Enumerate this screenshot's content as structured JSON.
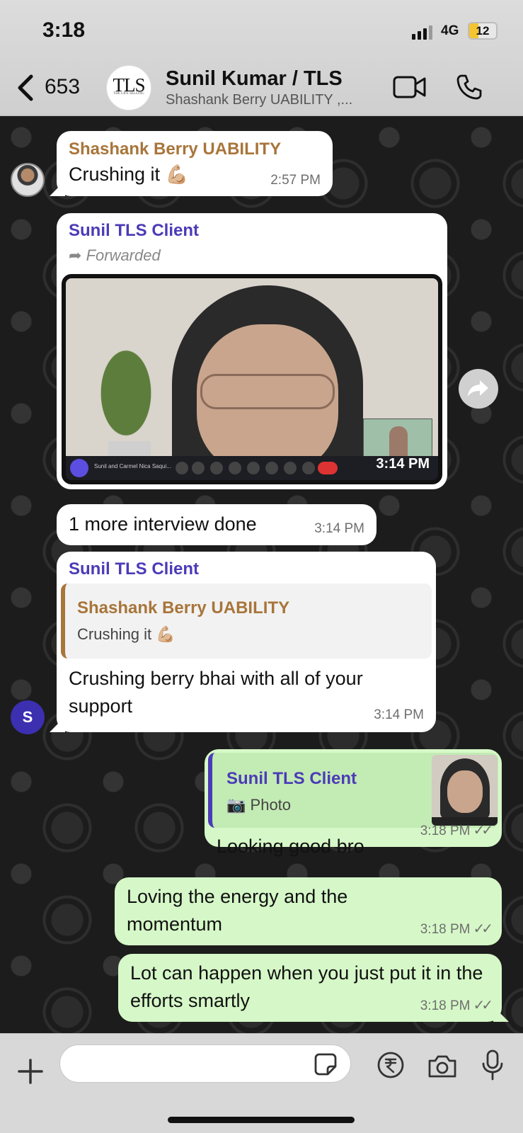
{
  "status": {
    "time": "3:18",
    "network": "4G",
    "battery": "12"
  },
  "header": {
    "back_count": "653",
    "title": "Sunil Kumar / TLS",
    "subtitle": "Shashank Berry UABILITY ,...",
    "avatar_text": "TLS",
    "avatar_subtext": "THE LIFE SELLING"
  },
  "messages": {
    "m1": {
      "sender": "Shashank Berry UABILITY",
      "text": "Crushing it",
      "emoji": "💪🏼",
      "time": "2:57 PM"
    },
    "m2": {
      "sender": "Sunil TLS Client",
      "forwarded": "Forwarded",
      "video_time": "3:14 PM",
      "call_label": "Sunil and Carmel Nica Saqui..."
    },
    "m3": {
      "text": "1 more interview done",
      "time": "3:14 PM"
    },
    "m4": {
      "sender": "Sunil TLS Client",
      "reply_sender": "Shashank Berry UABILITY",
      "reply_text": "Crushing it",
      "reply_emoji": "💪🏼",
      "text": "Crushing berry bhai with all of your support",
      "time": "3:14 PM",
      "avatar_letter": "S"
    },
    "m5": {
      "reply_sender": "Sunil TLS Client",
      "reply_label": "Photo",
      "text": "Looking good bro",
      "time": "3:18 PM"
    },
    "m6": {
      "text": "Loving the energy and the momentum",
      "time": "3:18 PM"
    },
    "m7": {
      "text": "Lot can happen when you just put it in the efforts smartly",
      "time": "3:18 PM"
    }
  },
  "input": {
    "placeholder": ""
  },
  "colors": {
    "sender_brown": "#a8753a",
    "sender_purple": "#4b3bb7",
    "outgoing_bubble": "#d6f8c8",
    "incoming_bubble": "#ffffff"
  }
}
